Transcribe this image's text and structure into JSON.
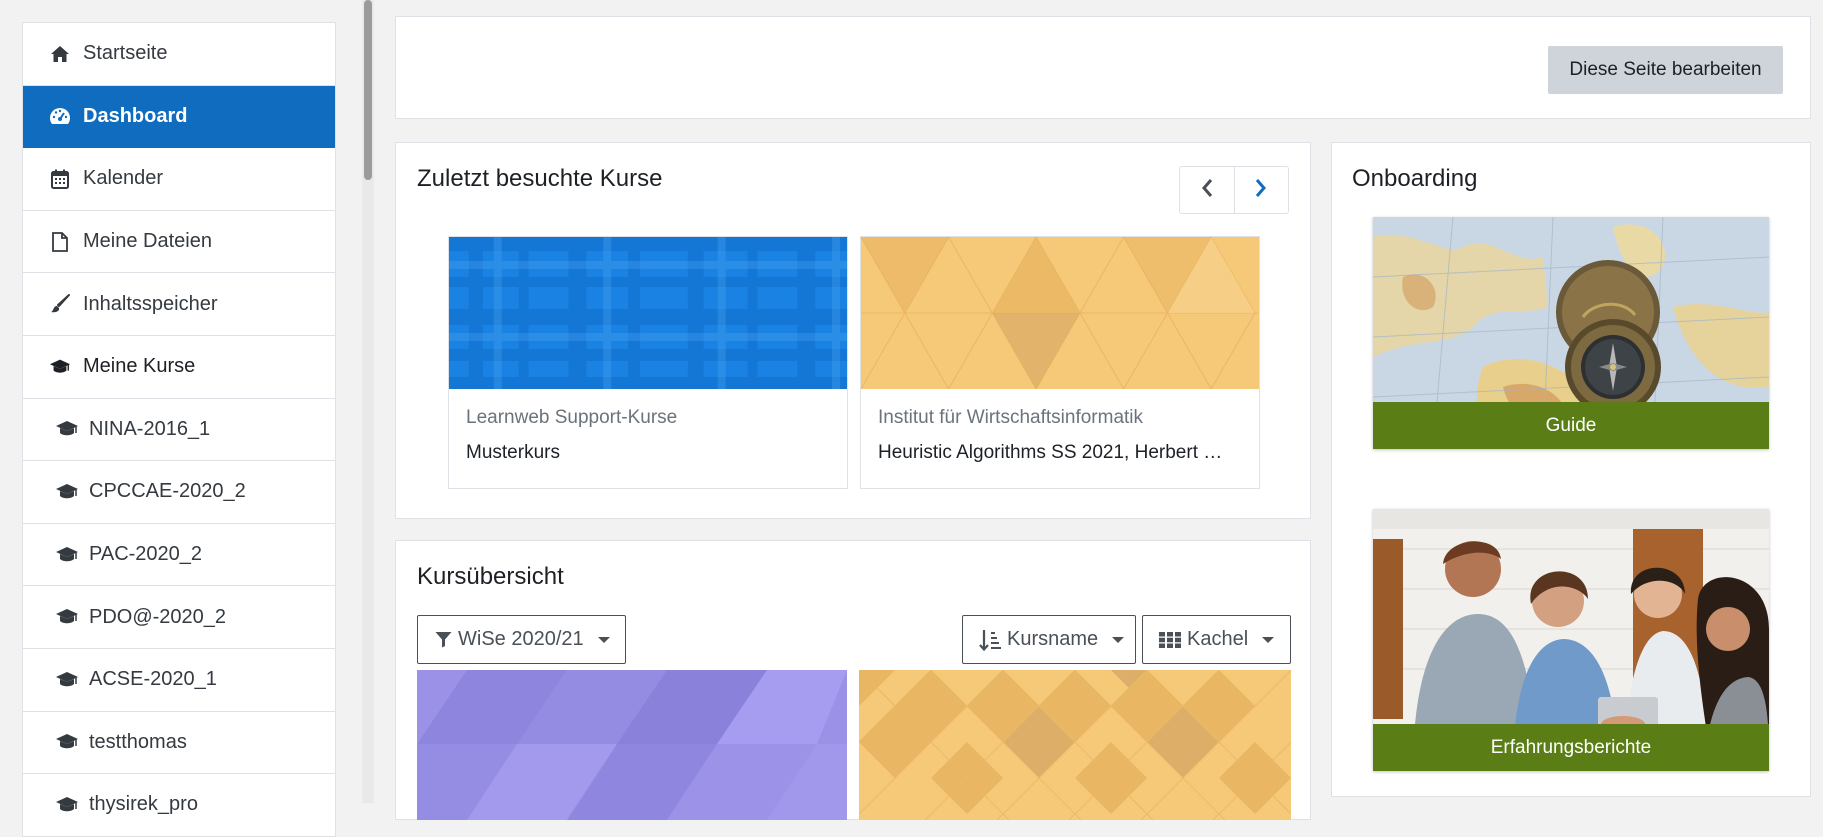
{
  "sidebar": {
    "items": [
      {
        "label": "Startseite",
        "icon": "home-icon"
      },
      {
        "label": "Dashboard",
        "icon": "dashboard-icon"
      },
      {
        "label": "Kalender",
        "icon": "calendar-icon"
      },
      {
        "label": "Meine Dateien",
        "icon": "file-icon"
      },
      {
        "label": "Inhaltsspeicher",
        "icon": "brush-icon"
      },
      {
        "label": "Meine Kurse",
        "icon": "graduation-cap-icon"
      }
    ],
    "courses": [
      {
        "label": "NINA-2016_1"
      },
      {
        "label": "CPCCAE-2020_2"
      },
      {
        "label": "PAC-2020_2"
      },
      {
        "label": "PDO@-2020_2"
      },
      {
        "label": "ACSE-2020_1"
      },
      {
        "label": "testthomas"
      },
      {
        "label": "thysirek_pro"
      }
    ]
  },
  "header": {
    "edit_button": "Diese Seite bearbeiten"
  },
  "recent": {
    "title": "Zuletzt besuchte Kurse",
    "courses": [
      {
        "category": "Learnweb Support-Kurse",
        "name": "Musterkurs"
      },
      {
        "category": "Institut für Wirtschaftsinformatik",
        "name": "Heuristic Algorithms SS 2021, Herbert …"
      }
    ]
  },
  "overview": {
    "title": "Kursübersicht",
    "filter": "WiSe 2020/21",
    "sort": "Kursname",
    "view": "Kachel"
  },
  "onboarding": {
    "title": "Onboarding",
    "items": [
      {
        "label": "Guide"
      },
      {
        "label": "Erfahrungsberichte"
      }
    ]
  },
  "colors": {
    "primary": "#0f6cbf",
    "onboarding_label": "#5a7e15",
    "edit_button": "#ced4da",
    "course_blue": "#1a82e2",
    "course_gold": "#f6c978",
    "course_purple": "#9b92e8"
  }
}
